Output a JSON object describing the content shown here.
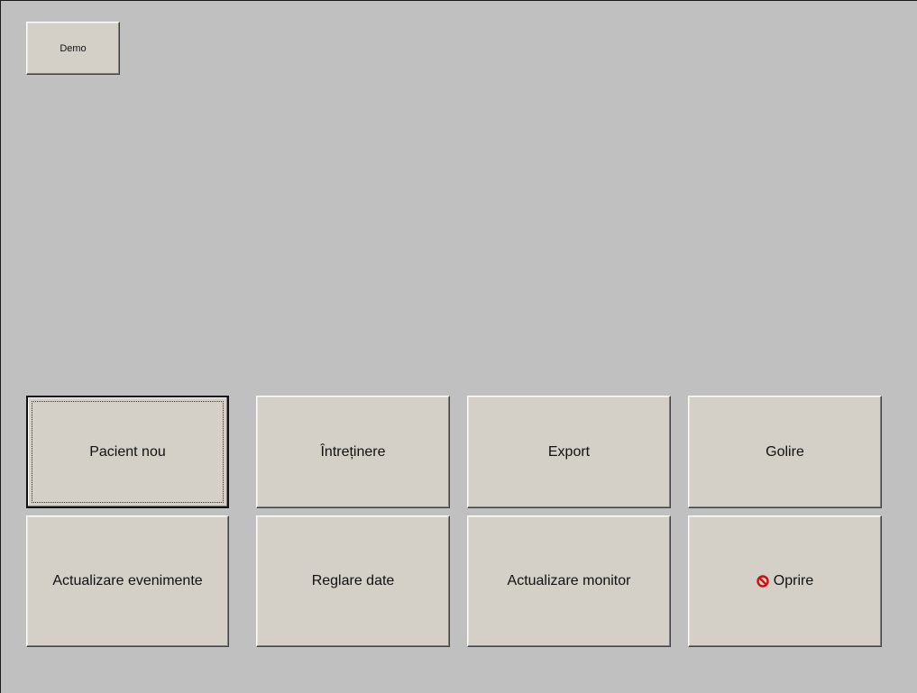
{
  "top": {
    "demo_label": "Demo"
  },
  "buttons": {
    "row1": [
      "Pacient nou",
      "Întreținere",
      "Export",
      "Golire"
    ],
    "row2": [
      "Actualizare evenimente",
      "Reglare date",
      "Actualizare monitor",
      "Oprire"
    ]
  },
  "icons": {
    "stop": "stop-icon",
    "stop_color": "#cc1111"
  }
}
